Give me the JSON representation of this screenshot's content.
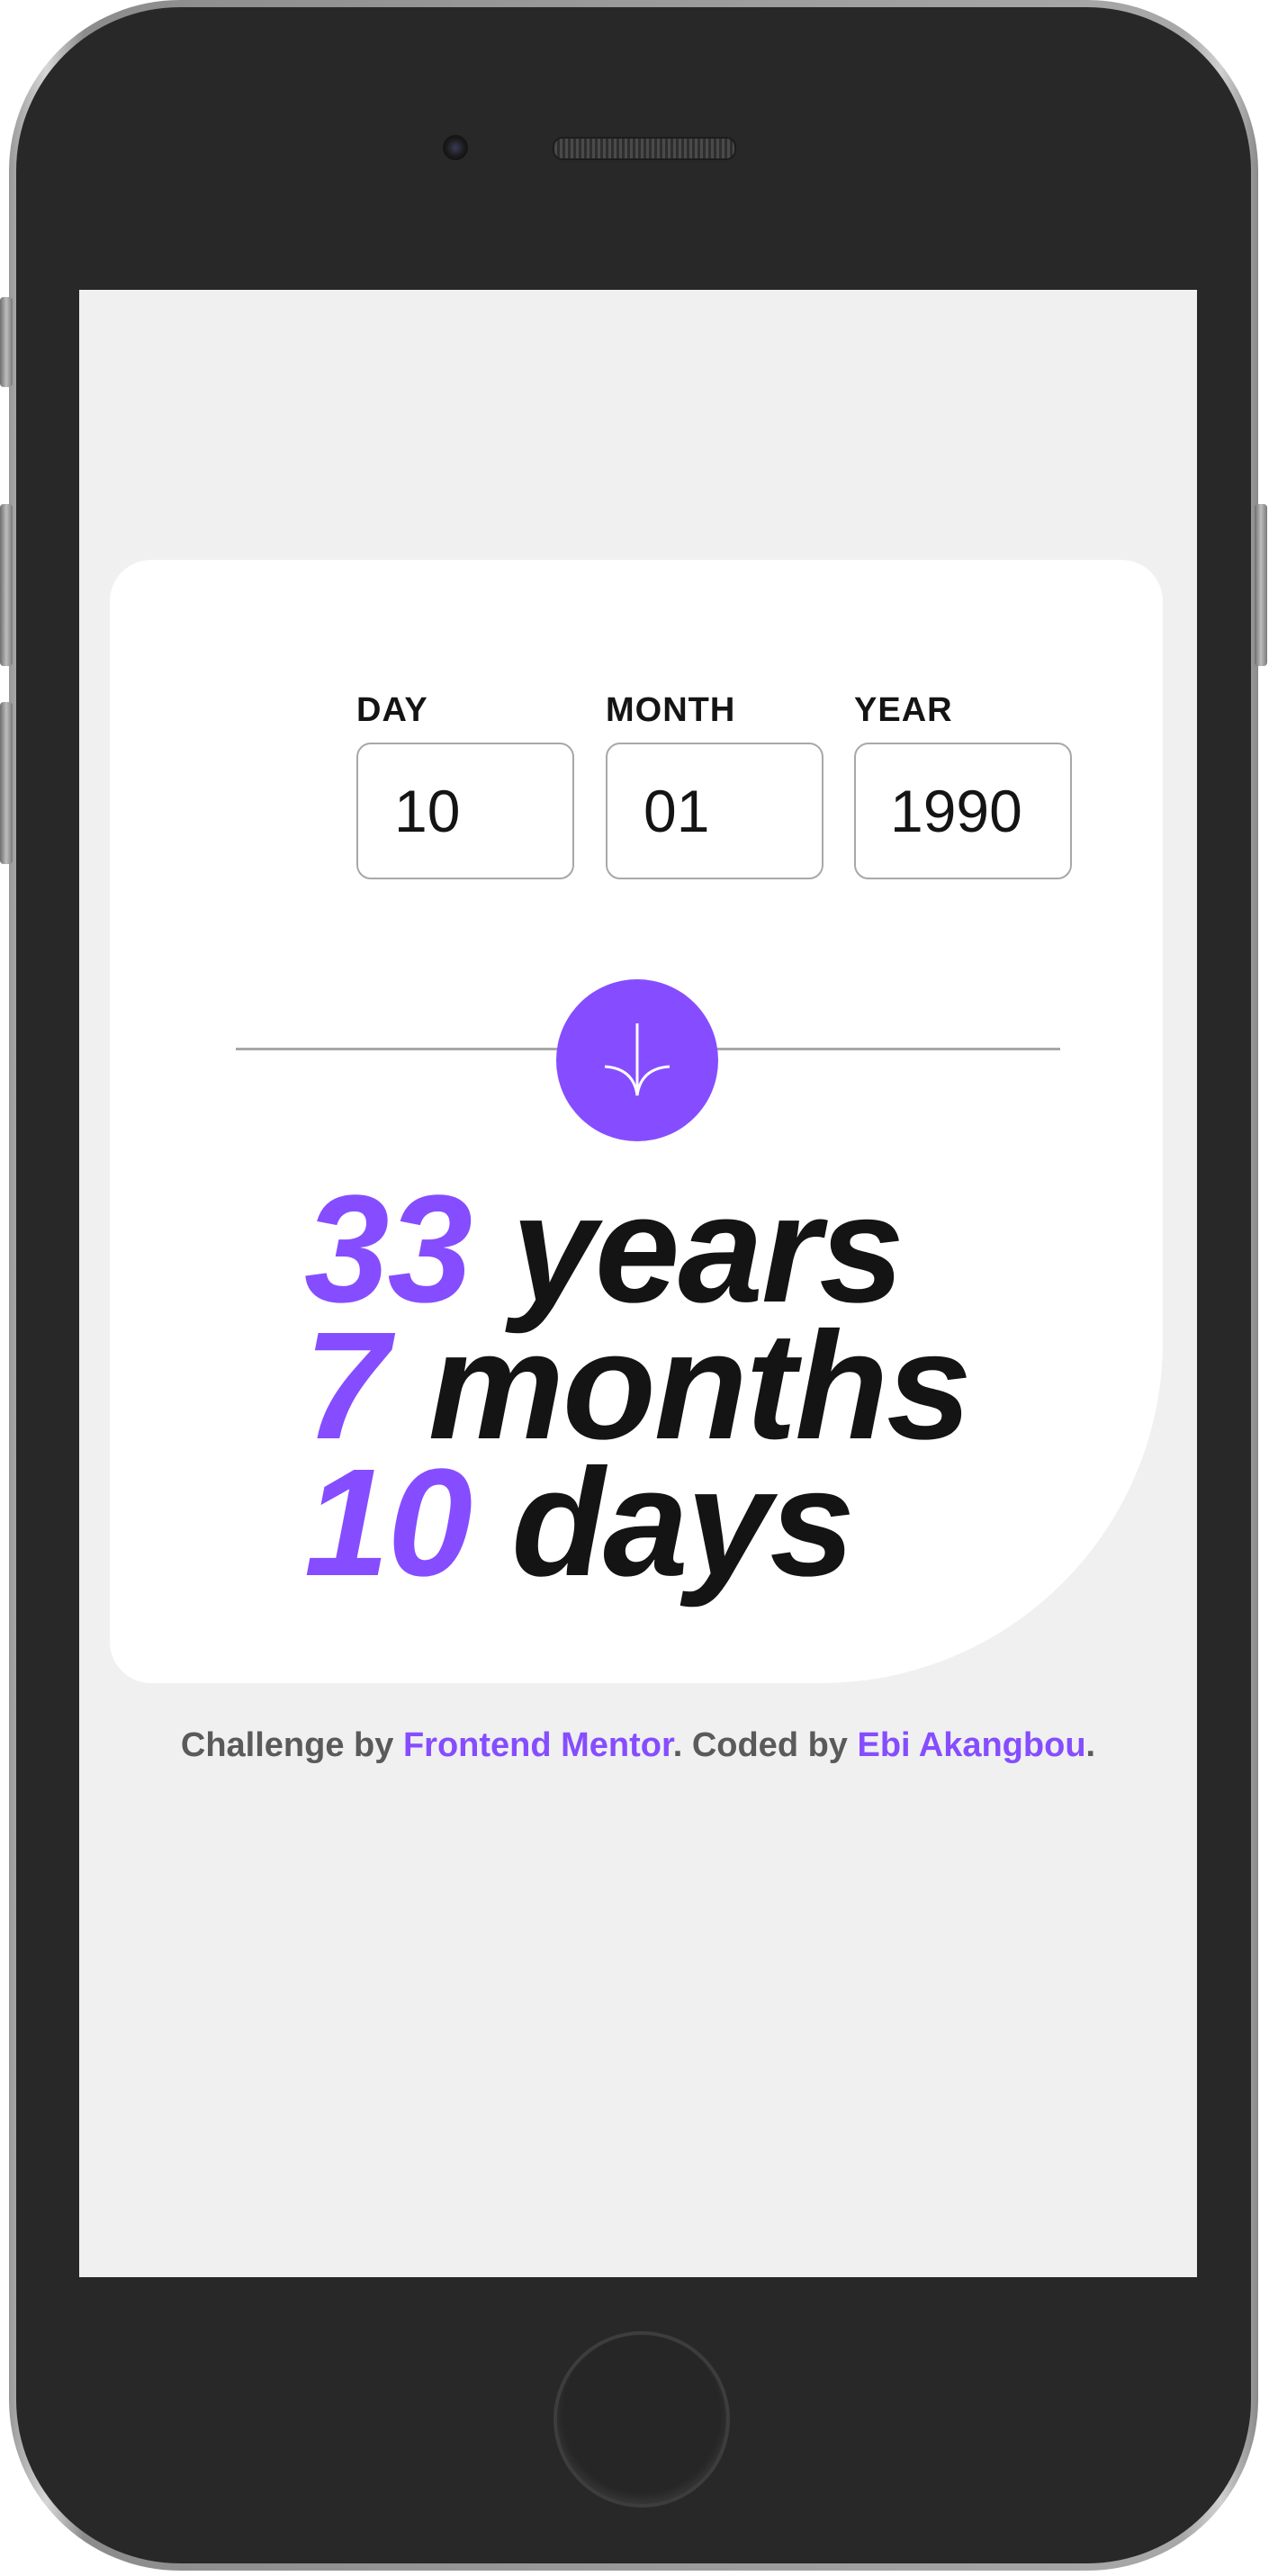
{
  "form": {
    "day_label": "DAY",
    "day_value": "10",
    "month_label": "MONTH",
    "month_value": "01",
    "year_label": "YEAR",
    "year_value": "1990"
  },
  "submit": {
    "icon": "arrow-down-icon"
  },
  "results": {
    "years_value": "33",
    "years_label": "years",
    "months_value": "7",
    "months_label": "months",
    "days_value": "10",
    "days_label": "days"
  },
  "attribution": {
    "prefix": "Challenge by ",
    "link1": "Frontend Mentor",
    "middle": ". Coded by ",
    "link2": "Ebi Akangbou",
    "suffix": "."
  },
  "colors": {
    "accent": "#854dff",
    "text": "#141414",
    "screen_bg": "#f0f0f0",
    "card_bg": "#ffffff"
  }
}
